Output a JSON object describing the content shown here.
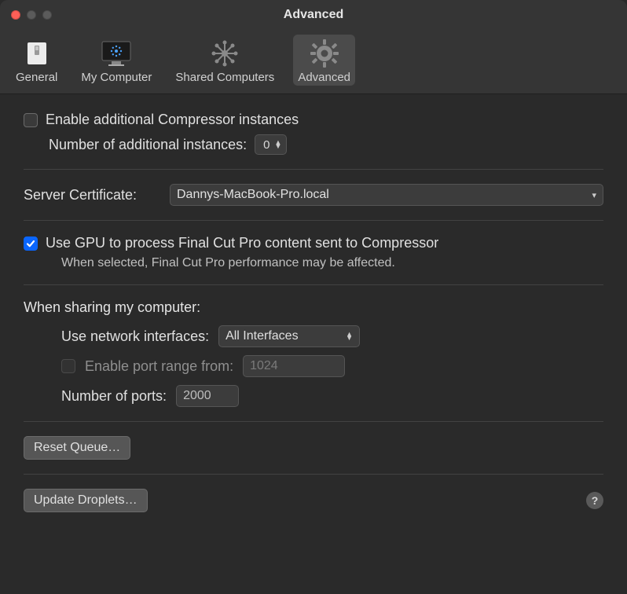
{
  "window": {
    "title": "Advanced"
  },
  "toolbar": {
    "items": [
      {
        "label": "General"
      },
      {
        "label": "My Computer"
      },
      {
        "label": "Shared Computers"
      },
      {
        "label": "Advanced"
      }
    ]
  },
  "instances": {
    "enable_label": "Enable additional Compressor instances",
    "count_label": "Number of additional instances:",
    "count_value": "0"
  },
  "server_cert": {
    "label": "Server Certificate:",
    "value": "Dannys-MacBook-Pro.local"
  },
  "gpu": {
    "label": "Use GPU to process Final Cut Pro content sent to Compressor",
    "hint": "When selected, Final Cut Pro performance may be affected."
  },
  "sharing": {
    "heading": "When sharing my computer:",
    "network_label": "Use network interfaces:",
    "network_value": "All Interfaces",
    "port_range_label": "Enable port range from:",
    "port_range_value": "1024",
    "num_ports_label": "Number of ports:",
    "num_ports_value": "2000"
  },
  "buttons": {
    "reset_queue": "Reset Queue…",
    "update_droplets": "Update Droplets…"
  }
}
